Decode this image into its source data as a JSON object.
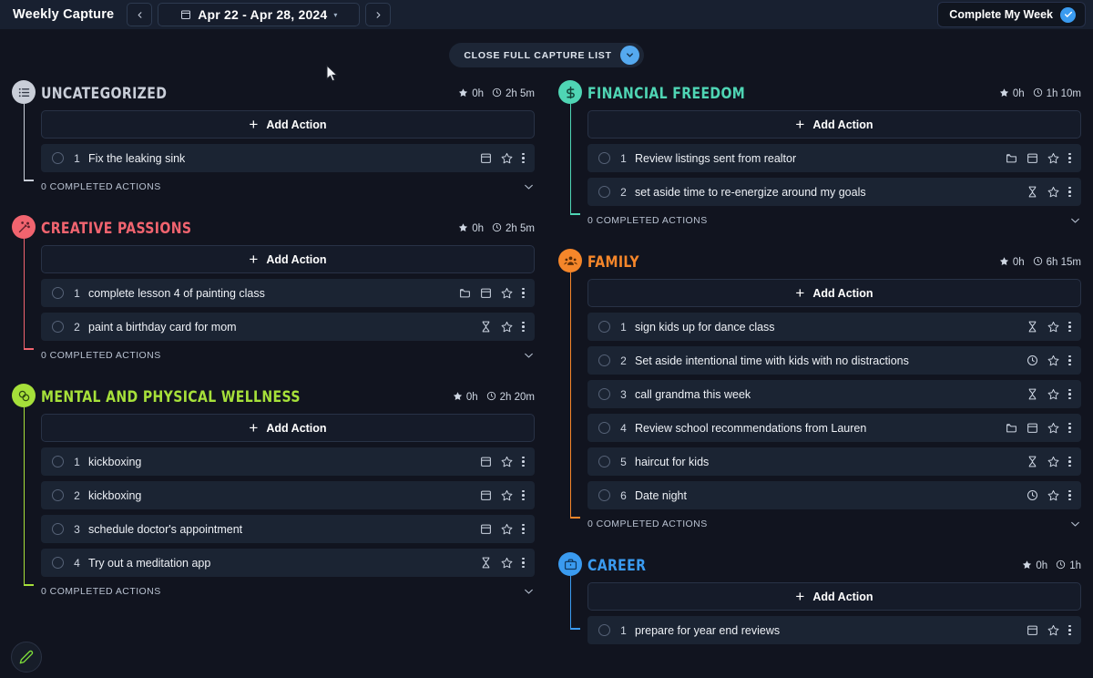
{
  "topbar": {
    "app_title": "Weekly Capture",
    "prev_label": "‹",
    "next_label": "›",
    "date_range": "Apr 22 - Apr 28, 2024",
    "date_caret": "▾",
    "complete_week_label": "Complete My Week"
  },
  "capture_toggle": {
    "label": "CLOSE FULL CAPTURE LIST"
  },
  "labels": {
    "add_action": "Add Action",
    "plus": "+"
  },
  "colors": {
    "accent_blue": "#3a9bf0",
    "uncategorized": "#c9ced8",
    "creative": "#f1646f",
    "wellness": "#a6e03a",
    "financial": "#4fd5b4",
    "family": "#f5862a",
    "career": "#3a9bf0",
    "row_bg": "#1b2433",
    "page_bg": "#11141f"
  },
  "sections": [
    {
      "id": "uncategorized",
      "column": "left",
      "title": "UNCATEGORIZED",
      "icon": "list-icon",
      "color": "#c9ced8",
      "icon_color": "#333a47",
      "starred_time": "0h",
      "estimated_time": "2h 5m",
      "completed_label": "0 COMPLETED ACTIONS",
      "actions": [
        {
          "index": "1",
          "text": "Fix the leaking sink",
          "icons": [
            "calendar-icon",
            "star-icon"
          ]
        }
      ]
    },
    {
      "id": "creative-passions",
      "column": "left",
      "title": "CREATIVE PASSIONS",
      "icon": "magic-wand-icon",
      "color": "#f1646f",
      "icon_color": "#5c1f2a",
      "starred_time": "0h",
      "estimated_time": "2h 5m",
      "completed_label": "0 COMPLETED ACTIONS",
      "actions": [
        {
          "index": "1",
          "text": "complete lesson 4 of painting class",
          "icons": [
            "folder-icon",
            "calendar-icon",
            "star-icon"
          ]
        },
        {
          "index": "2",
          "text": "paint a birthday card for mom",
          "icons": [
            "hourglass-icon",
            "star-icon"
          ]
        }
      ]
    },
    {
      "id": "mental-and-physical-wellness",
      "column": "left",
      "title": "MENTAL AND PHYSICAL WELLNESS",
      "icon": "yin-yang-icon",
      "color": "#a6e03a",
      "icon_color": "#2f4a12",
      "starred_time": "0h",
      "estimated_time": "2h 20m",
      "completed_label": "0 COMPLETED ACTIONS",
      "actions": [
        {
          "index": "1",
          "text": "kickboxing",
          "icons": [
            "calendar-icon",
            "star-icon"
          ]
        },
        {
          "index": "2",
          "text": "kickboxing",
          "icons": [
            "calendar-icon",
            "star-icon"
          ]
        },
        {
          "index": "3",
          "text": "schedule doctor's appointment",
          "icons": [
            "calendar-icon",
            "star-icon"
          ]
        },
        {
          "index": "4",
          "text": "Try out a meditation app",
          "icons": [
            "hourglass-icon",
            "star-icon"
          ]
        }
      ]
    },
    {
      "id": "financial-freedom",
      "column": "right",
      "title": "FINANCIAL FREEDOM",
      "icon": "dollar-icon",
      "color": "#4fd5b4",
      "icon_color": "#124338",
      "starred_time": "0h",
      "estimated_time": "1h 10m",
      "completed_label": "0 COMPLETED ACTIONS",
      "actions": [
        {
          "index": "1",
          "text": "Review listings sent from realtor",
          "icons": [
            "folder-icon",
            "calendar-icon",
            "star-icon"
          ]
        },
        {
          "index": "2",
          "text": "set aside time to re-energize around my goals",
          "icons": [
            "hourglass-icon",
            "star-icon"
          ]
        }
      ]
    },
    {
      "id": "family",
      "column": "right",
      "title": "FAMILY",
      "icon": "people-icon",
      "color": "#f5862a",
      "icon_color": "#5a2c06",
      "starred_time": "0h",
      "estimated_time": "6h 15m",
      "completed_label": "0 COMPLETED ACTIONS",
      "actions": [
        {
          "index": "1",
          "text": "sign kids up for dance class",
          "icons": [
            "hourglass-icon",
            "star-icon"
          ]
        },
        {
          "index": "2",
          "text": "Set aside intentional time with kids with no distractions",
          "icons": [
            "clock-icon",
            "star-icon"
          ]
        },
        {
          "index": "3",
          "text": "call grandma this week",
          "icons": [
            "hourglass-icon",
            "star-icon"
          ]
        },
        {
          "index": "4",
          "text": "Review school recommendations from Lauren",
          "icons": [
            "folder-icon",
            "calendar-icon",
            "star-icon"
          ]
        },
        {
          "index": "5",
          "text": "haircut for kids",
          "icons": [
            "hourglass-icon",
            "star-icon"
          ]
        },
        {
          "index": "6",
          "text": "Date night",
          "icons": [
            "clock-icon",
            "star-icon"
          ]
        }
      ]
    },
    {
      "id": "career",
      "column": "right",
      "title": "CAREER",
      "icon": "briefcase-icon",
      "color": "#3a9bf0",
      "icon_color": "#10385e",
      "starred_time": "0h",
      "estimated_time": "1h",
      "completed_label": "",
      "actions": [
        {
          "index": "1",
          "text": "prepare for year end reviews",
          "icons": [
            "calendar-icon",
            "star-icon"
          ]
        }
      ]
    }
  ]
}
